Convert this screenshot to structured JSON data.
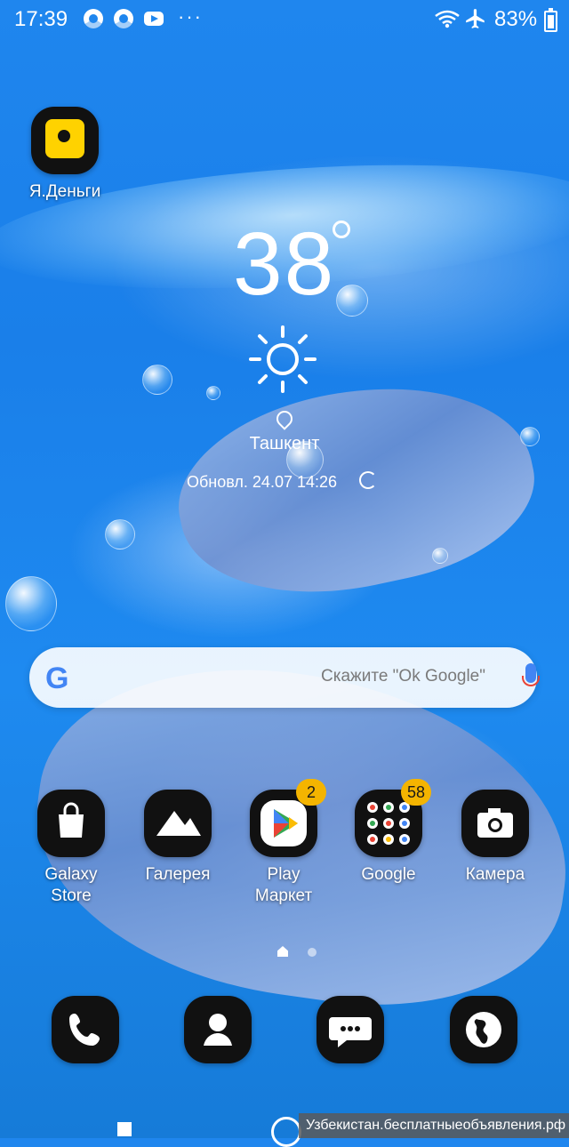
{
  "status_bar": {
    "time": "17:39",
    "more": "···",
    "battery": "83%",
    "icons": [
      "chrome-icon",
      "chrome-icon",
      "youtube-icon",
      "wifi-icon",
      "airplane-mode-icon",
      "battery-charging-icon"
    ]
  },
  "apps_top": [
    {
      "label": "Я.Деньги",
      "icon": "yandex-money-icon",
      "accent": "#ffd200"
    }
  ],
  "weather": {
    "temperature": "38",
    "unit_icon": "degree-symbol",
    "condition_icon": "sun-icon",
    "city": "Ташкент",
    "updated": "Обновл. 24.07 14:26"
  },
  "search": {
    "logo": "G",
    "placeholder": "Скажите \"Ok Google\"",
    "mic_icon": "microphone-icon"
  },
  "apps_row": [
    {
      "label": "Galaxy Store",
      "icon": "shopping-bag-icon",
      "badge": ""
    },
    {
      "label": "Галерея",
      "icon": "mountains-icon",
      "badge": ""
    },
    {
      "label": "Play Маркет",
      "icon": "play-store-icon",
      "badge": "2"
    },
    {
      "label": "Google",
      "icon": "folder-icon",
      "badge": "58"
    },
    {
      "label": "Камера",
      "icon": "camera-icon",
      "badge": ""
    }
  ],
  "dock": [
    {
      "icon": "phone-icon"
    },
    {
      "icon": "contacts-icon"
    },
    {
      "icon": "messages-icon"
    },
    {
      "icon": "internet-icon"
    }
  ],
  "watermark": "Узбекистан.бесплатныеобъявления.рф",
  "colors": {
    "badge": "#f4b400",
    "google_blue": "#4285f4",
    "background": "#1f86ee"
  }
}
